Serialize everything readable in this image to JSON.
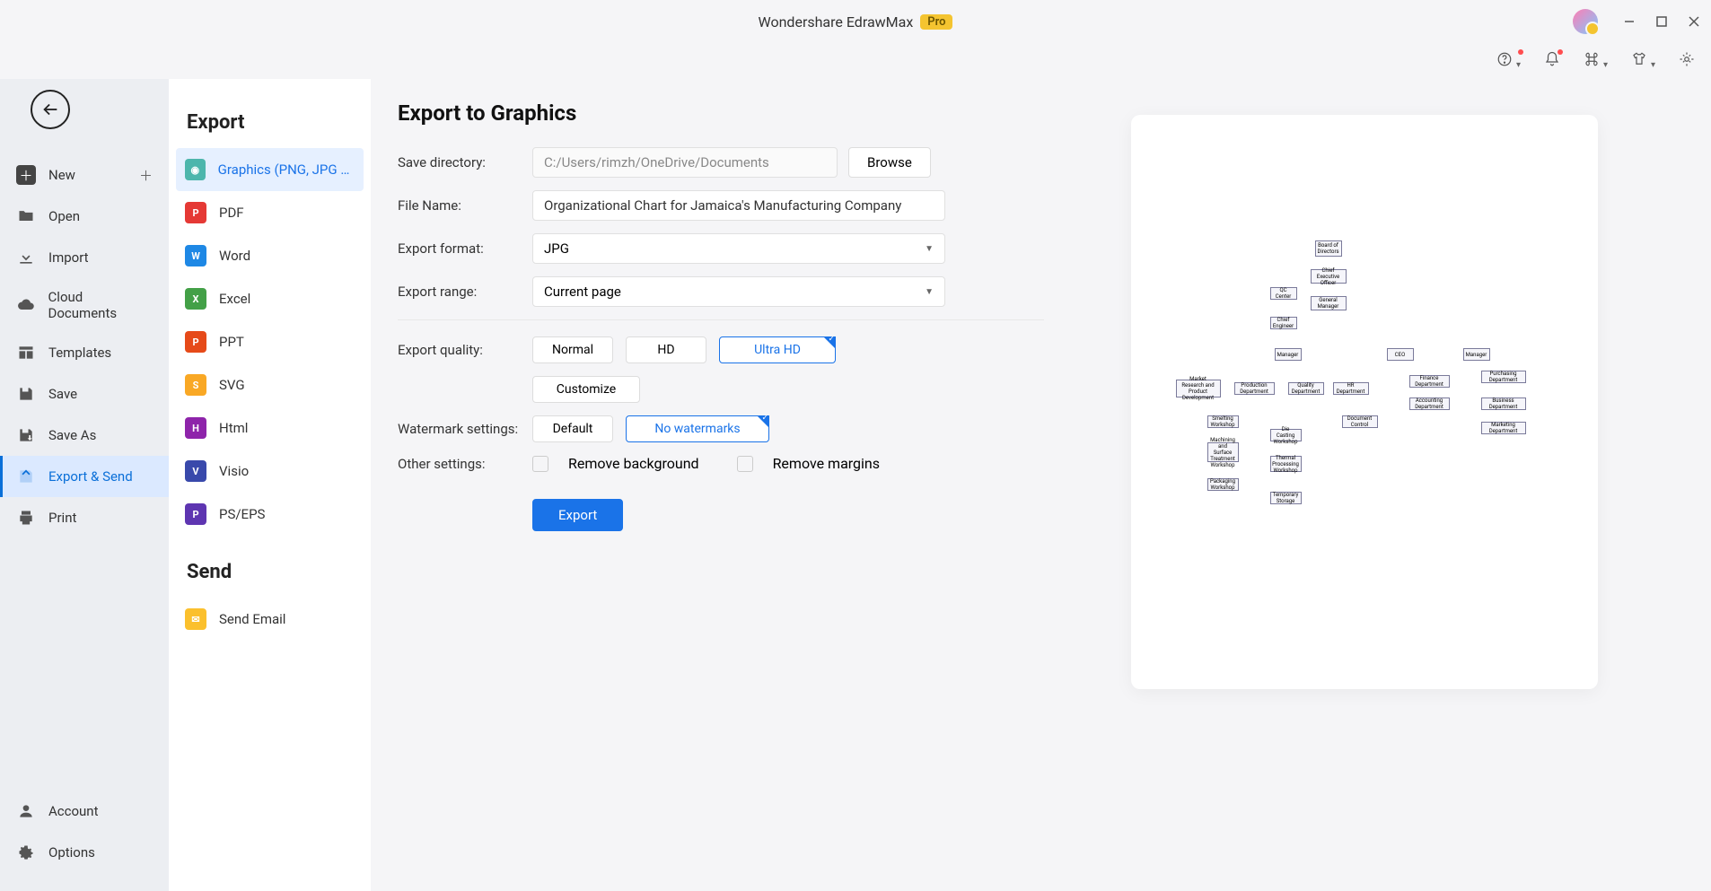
{
  "titlebar": {
    "title": "Wondershare EdrawMax",
    "badge": "Pro"
  },
  "leftrail": {
    "items": [
      {
        "label": "New",
        "icon": "plus-box",
        "hasPlus": true
      },
      {
        "label": "Open",
        "icon": "folder"
      },
      {
        "label": "Import",
        "icon": "download"
      },
      {
        "label": "Cloud Documents",
        "icon": "cloud"
      },
      {
        "label": "Templates",
        "icon": "template"
      },
      {
        "label": "Save",
        "icon": "save"
      },
      {
        "label": "Save As",
        "icon": "save-as"
      },
      {
        "label": "Export & Send",
        "icon": "export",
        "active": true
      },
      {
        "label": "Print",
        "icon": "print"
      }
    ],
    "bottom": [
      {
        "label": "Account",
        "icon": "account"
      },
      {
        "label": "Options",
        "icon": "gear"
      }
    ]
  },
  "exportPanel": {
    "heading": "Export",
    "sendHeading": "Send",
    "formats": [
      {
        "label": "Graphics (PNG, JPG et...",
        "color": "#4db6ac",
        "active": true
      },
      {
        "label": "PDF",
        "color": "#e53935"
      },
      {
        "label": "Word",
        "color": "#1e88e5"
      },
      {
        "label": "Excel",
        "color": "#43a047"
      },
      {
        "label": "PPT",
        "color": "#e64a19"
      },
      {
        "label": "SVG",
        "color": "#f9a825"
      },
      {
        "label": "Html",
        "color": "#8e24aa"
      },
      {
        "label": "Visio",
        "color": "#3949ab"
      },
      {
        "label": "PS/EPS",
        "color": "#5e35b1"
      }
    ],
    "send": [
      {
        "label": "Send Email",
        "color": "#fbc02d"
      }
    ]
  },
  "form": {
    "title": "Export to Graphics",
    "saveDirLabel": "Save directory:",
    "saveDir": "C:/Users/rimzh/OneDrive/Documents",
    "browse": "Browse",
    "fileNameLabel": "File Name:",
    "fileName": "Organizational Chart for Jamaica's Manufacturing Company",
    "formatLabel": "Export format:",
    "format": "JPG",
    "rangeLabel": "Export range:",
    "range": "Current page",
    "qualityLabel": "Export quality:",
    "quality": {
      "normal": "Normal",
      "hd": "HD",
      "ultra": "Ultra HD",
      "customize": "Customize"
    },
    "watermarkLabel": "Watermark settings:",
    "watermark": {
      "default": "Default",
      "none": "No watermarks"
    },
    "otherLabel": "Other settings:",
    "other": {
      "removeBg": "Remove background",
      "removeMargins": "Remove margins"
    },
    "exportBtn": "Export"
  },
  "chart_data": {
    "type": "diagram",
    "title": "Organizational Chart",
    "nodes": [
      "Board of Directors",
      "Chief Executive Officer",
      "QC Center",
      "General Manager",
      "Chief Engineer",
      "Manager",
      "CEO",
      "Manager",
      "Market Research and Product Development",
      "Production Department",
      "Quality Department",
      "HR Department",
      "Finance Department",
      "Purchasing Department",
      "Accounting Department",
      "Business Department",
      "Document Control",
      "Marketing Department",
      "Smelting Workshop",
      "Die Casting Workshop",
      "Machining and Surface Treatment Workshop",
      "Thermal Processing Workshop",
      "Packaging Workshop",
      "Temporary Storage"
    ]
  }
}
